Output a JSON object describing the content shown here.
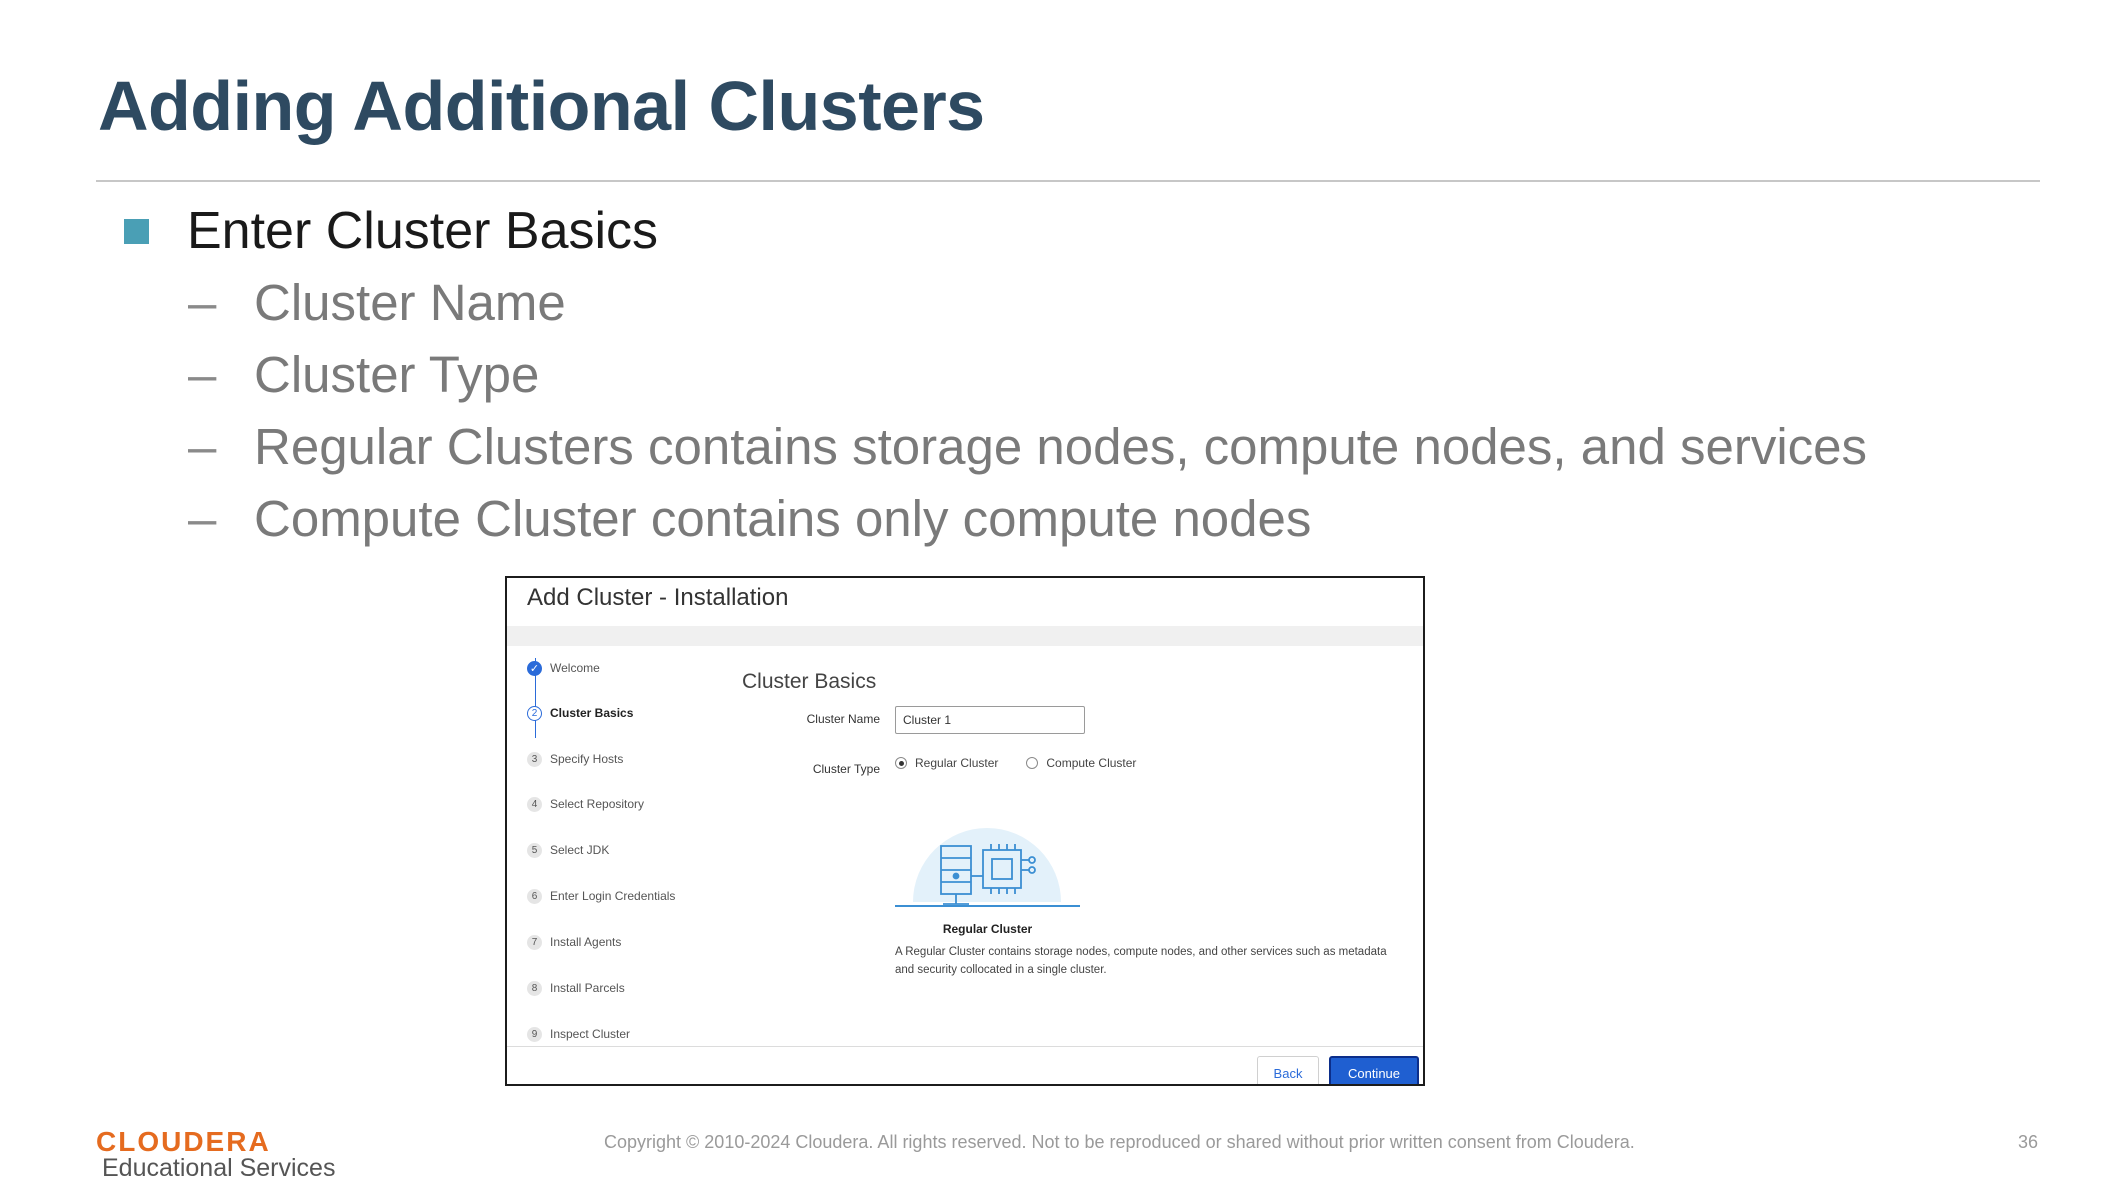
{
  "slide": {
    "title": "Adding Additional Clusters",
    "main_bullet": "Enter Cluster Basics",
    "sub_bullets": [
      "Cluster Name",
      "Cluster Type",
      "Regular Clusters contains storage nodes, compute nodes, and services",
      "Compute Cluster contains only compute nodes"
    ],
    "dash": "–"
  },
  "dialog": {
    "title": "Add Cluster - Installation",
    "steps": [
      {
        "num": "✓",
        "label": "Welcome",
        "state": "done"
      },
      {
        "num": "2",
        "label": "Cluster Basics",
        "state": "current"
      },
      {
        "num": "3",
        "label": "Specify Hosts",
        "state": "pending"
      },
      {
        "num": "4",
        "label": "Select Repository",
        "state": "pending"
      },
      {
        "num": "5",
        "label": "Select JDK",
        "state": "pending"
      },
      {
        "num": "6",
        "label": "Enter Login Credentials",
        "state": "pending"
      },
      {
        "num": "7",
        "label": "Install Agents",
        "state": "pending"
      },
      {
        "num": "8",
        "label": "Install Parcels",
        "state": "pending"
      },
      {
        "num": "9",
        "label": "Inspect Cluster",
        "state": "pending"
      }
    ],
    "section_title": "Cluster Basics",
    "cluster_name_label": "Cluster Name",
    "cluster_name_value": "Cluster 1",
    "cluster_type_label": "Cluster Type",
    "radio_regular": "Regular Cluster",
    "radio_compute": "Compute Cluster",
    "selected_type": "Regular Cluster",
    "illustration_caption": "Regular Cluster",
    "illustration_desc": "A Regular Cluster contains storage nodes, compute nodes, and other services such as metadata and security collocated in a single cluster.",
    "back_label": "Back",
    "continue_label": "Continue"
  },
  "footer": {
    "logo": "CLOUDERA",
    "logo_sub": "Educational Services",
    "copyright": "Copyright © 2010-2024  Cloudera. All rights reserved. Not to be reproduced or shared without prior written consent from Cloudera.",
    "page_number": "36"
  },
  "colors": {
    "title": "#2e4a61",
    "bullet_square": "#4a9fb5",
    "accent_blue": "#1f5fd1",
    "logo_orange": "#e56b1f"
  }
}
